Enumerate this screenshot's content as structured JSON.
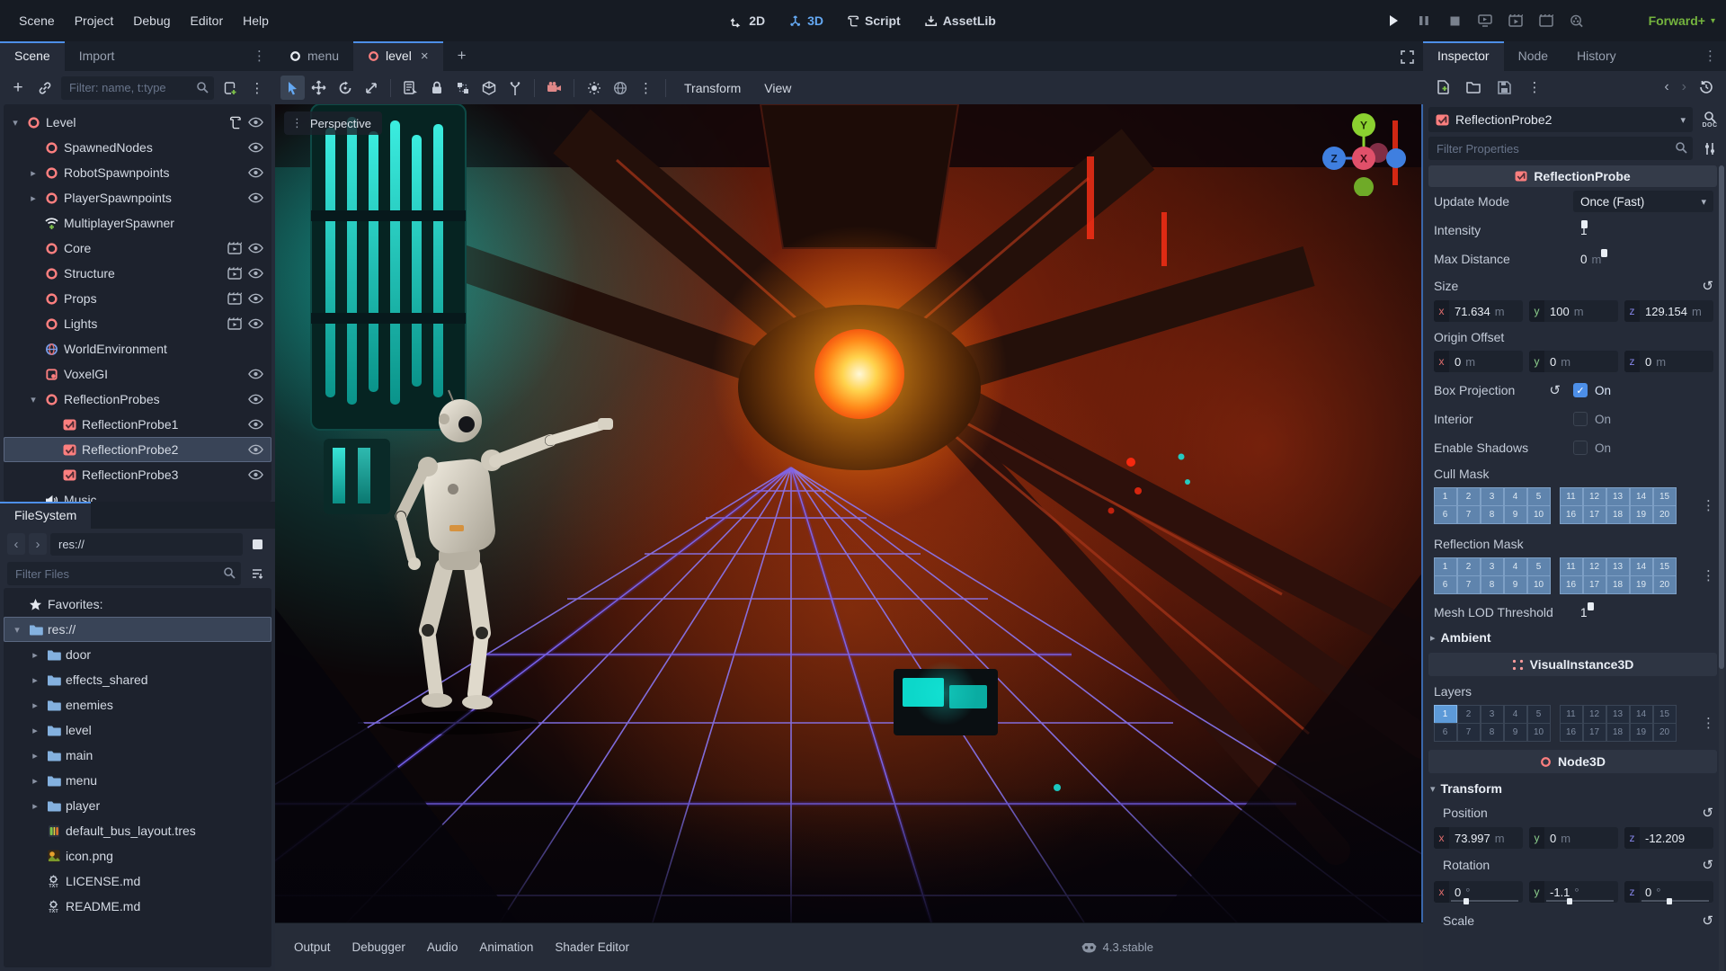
{
  "menubar": {
    "menus": [
      "Scene",
      "Project",
      "Debug",
      "Editor",
      "Help"
    ],
    "workspaces": [
      {
        "label": "2D",
        "active": false
      },
      {
        "label": "3D",
        "active": true
      },
      {
        "label": "Script",
        "active": false
      },
      {
        "label": "AssetLib",
        "active": false
      }
    ],
    "renderer": "Forward+",
    "accent_color": "#4d8fe8",
    "renderer_color": "#74b33e"
  },
  "scene_dock": {
    "tabs": [
      {
        "label": "Scene",
        "active": true
      },
      {
        "label": "Import",
        "active": false
      }
    ],
    "filter_placeholder": "Filter: name, t:type",
    "tree": [
      {
        "label": "Level",
        "icon": "node3d",
        "depth": 0,
        "arrow": "down",
        "badges": [
          "script"
        ],
        "eye": true
      },
      {
        "label": "SpawnedNodes",
        "icon": "node3d",
        "depth": 1,
        "arrow": "",
        "badges": [],
        "eye": true
      },
      {
        "label": "RobotSpawnpoints",
        "icon": "node3d",
        "depth": 1,
        "arrow": "right",
        "badges": [],
        "eye": true
      },
      {
        "label": "PlayerSpawnpoints",
        "icon": "node3d",
        "depth": 1,
        "arrow": "right",
        "badges": [],
        "eye": true
      },
      {
        "label": "MultiplayerSpawner",
        "icon": "spawner",
        "depth": 1,
        "arrow": "",
        "badges": [],
        "eye": false
      },
      {
        "label": "Core",
        "icon": "node3d",
        "depth": 1,
        "arrow": "",
        "badges": [
          "instance"
        ],
        "eye": true
      },
      {
        "label": "Structure",
        "icon": "node3d",
        "depth": 1,
        "arrow": "",
        "badges": [
          "instance"
        ],
        "eye": true
      },
      {
        "label": "Props",
        "icon": "node3d",
        "depth": 1,
        "arrow": "",
        "badges": [
          "instance"
        ],
        "eye": true
      },
      {
        "label": "Lights",
        "icon": "node3d",
        "depth": 1,
        "arrow": "",
        "badges": [
          "instance"
        ],
        "eye": true
      },
      {
        "label": "WorldEnvironment",
        "icon": "environment",
        "depth": 1,
        "arrow": "",
        "badges": [],
        "eye": false
      },
      {
        "label": "VoxelGI",
        "icon": "voxelgi",
        "depth": 1,
        "arrow": "",
        "badges": [],
        "eye": true
      },
      {
        "label": "ReflectionProbes",
        "icon": "node3d",
        "depth": 1,
        "arrow": "down",
        "badges": [],
        "eye": true
      },
      {
        "label": "ReflectionProbe1",
        "icon": "probe",
        "depth": 2,
        "arrow": "",
        "badges": [],
        "eye": true
      },
      {
        "label": "ReflectionProbe2",
        "icon": "probe",
        "depth": 2,
        "arrow": "",
        "badges": [],
        "eye": true,
        "selected": true
      },
      {
        "label": "ReflectionProbe3",
        "icon": "probe",
        "depth": 2,
        "arrow": "",
        "badges": [],
        "eye": true
      },
      {
        "label": "Music",
        "icon": "audio",
        "depth": 1,
        "arrow": "",
        "badges": [],
        "eye": false
      }
    ]
  },
  "filesystem": {
    "tab": "FileSystem",
    "path": "res://",
    "filter_placeholder": "Filter Files",
    "items": [
      {
        "label": "Favorites:",
        "icon": "star",
        "depth": 0,
        "arrow": ""
      },
      {
        "label": "res://",
        "icon": "folder",
        "depth": 0,
        "arrow": "down",
        "selected": true
      },
      {
        "label": "door",
        "icon": "folder",
        "depth": 1,
        "arrow": "right"
      },
      {
        "label": "effects_shared",
        "icon": "folder",
        "depth": 1,
        "arrow": "right"
      },
      {
        "label": "enemies",
        "icon": "folder",
        "depth": 1,
        "arrow": "right"
      },
      {
        "label": "level",
        "icon": "folder",
        "depth": 1,
        "arrow": "right"
      },
      {
        "label": "main",
        "icon": "folder",
        "depth": 1,
        "arrow": "right"
      },
      {
        "label": "menu",
        "icon": "folder",
        "depth": 1,
        "arrow": "right"
      },
      {
        "label": "player",
        "icon": "folder",
        "depth": 1,
        "arrow": "right"
      },
      {
        "label": "default_bus_layout.tres",
        "icon": "busfile",
        "depth": 1,
        "arrow": ""
      },
      {
        "label": "icon.png",
        "icon": "image",
        "depth": 1,
        "arrow": ""
      },
      {
        "label": "LICENSE.md",
        "icon": "textfile",
        "depth": 1,
        "arrow": ""
      },
      {
        "label": "README.md",
        "icon": "textfile",
        "depth": 1,
        "arrow": ""
      }
    ]
  },
  "viewport": {
    "tabs": [
      {
        "label": "menu",
        "active": false,
        "icon_color": "#e8ecf2",
        "closable": false
      },
      {
        "label": "level",
        "active": true,
        "icon_color": "#fc7f7f",
        "closable": true
      }
    ],
    "menus": [
      "Transform",
      "View"
    ],
    "overlay_label": "Perspective"
  },
  "bottom_bar": {
    "panels": [
      "Output",
      "Debugger",
      "Audio",
      "Animation",
      "Shader Editor"
    ],
    "version": "4.3.stable"
  },
  "inspector": {
    "tabs": [
      {
        "label": "Inspector",
        "active": true
      },
      {
        "label": "Node",
        "active": false
      },
      {
        "label": "History",
        "active": false
      }
    ],
    "node_name": "ReflectionProbe2",
    "filter_placeholder": "Filter Properties",
    "class_header": "ReflectionProbe",
    "rows": {
      "update_mode": {
        "label": "Update Mode",
        "value": "Once (Fast)"
      },
      "intensity": {
        "label": "Intensity",
        "value": "1"
      },
      "max_distance": {
        "label": "Max Distance",
        "value": "0",
        "unit": "m"
      },
      "size": {
        "label": "Size",
        "x": "71.634",
        "y": "100",
        "z": "129.154",
        "unit": "m"
      },
      "origin_offset": {
        "label": "Origin Offset",
        "x": "0",
        "y": "0",
        "z": "0",
        "unit": "m"
      },
      "box_projection": {
        "label": "Box Projection",
        "value": "On",
        "checked": true
      },
      "interior": {
        "label": "Interior",
        "value": "On",
        "checked": false
      },
      "enable_shadows": {
        "label": "Enable Shadows",
        "value": "On",
        "checked": false
      },
      "cull_mask": {
        "label": "Cull Mask",
        "enabled": [
          1,
          2,
          3,
          4,
          5,
          6,
          7,
          8,
          9,
          10,
          11,
          12,
          13,
          14,
          15,
          16,
          17,
          18,
          19,
          20
        ]
      },
      "reflection_mask": {
        "label": "Reflection Mask",
        "enabled": [
          1,
          2,
          3,
          4,
          5,
          6,
          7,
          8,
          9,
          10,
          11,
          12,
          13,
          14,
          15,
          16,
          17,
          18,
          19,
          20
        ]
      },
      "mesh_lod": {
        "label": "Mesh LOD Threshold",
        "value": "1"
      },
      "ambient_section": "Ambient",
      "visualinstance_header": "VisualInstance3D",
      "layers": {
        "label": "Layers",
        "enabled": [
          1
        ]
      },
      "node3d_header": "Node3D",
      "transform_section": "Transform",
      "position": {
        "label": "Position",
        "x": "73.997",
        "y": "0",
        "z": "-12.209",
        "unit": "m"
      },
      "rotation": {
        "label": "Rotation",
        "x": "0",
        "y": "-1.1",
        "z": "0",
        "unit": "°"
      },
      "scale": {
        "label": "Scale"
      }
    },
    "mask_colors": {
      "enabled": "#5f84ad",
      "layer_active": "#5d9ad8"
    }
  }
}
